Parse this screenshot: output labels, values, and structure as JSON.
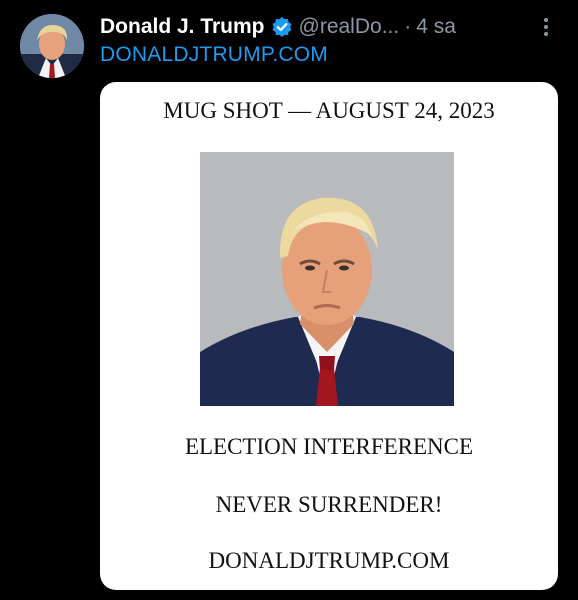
{
  "tweet": {
    "display_name": "Donald J. Trump",
    "handle": "@realDo...",
    "separator": "·",
    "time": "4 sa",
    "link_text": "DONALDJTRUMP.COM",
    "verified_badge_color": "#1d9bf0",
    "link_color": "#1d9bf0",
    "icons": {
      "verified": "verified-badge-icon",
      "more": "more-options-icon"
    }
  },
  "card": {
    "title": "MUG SHOT — AUGUST 24, 2023",
    "line1": "ELECTION INTERFERENCE",
    "line2": "NEVER SURRENDER!",
    "line3": "DONALDJTRUMP.COM"
  }
}
